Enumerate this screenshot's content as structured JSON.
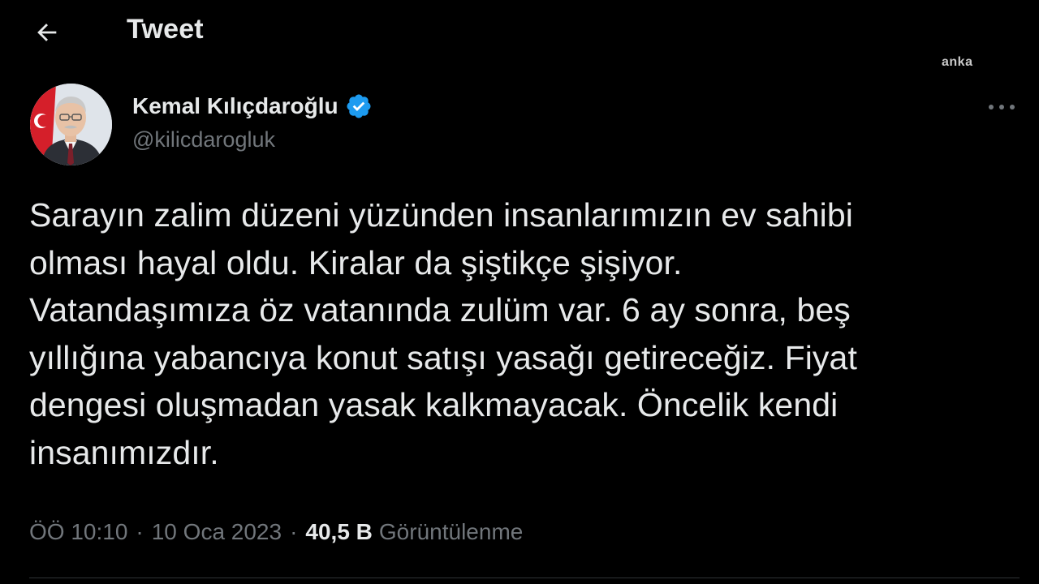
{
  "header": {
    "title": "Tweet",
    "back_icon": "arrow-left-icon",
    "watermark": "anka"
  },
  "author": {
    "name": "Kemal Kılıçdaroğlu",
    "handle": "@kilicdarogluk",
    "verified": true,
    "verified_color": "#1d9bf0",
    "avatar": "avatar-photo"
  },
  "tweet": {
    "text": "Sarayın zalim düzeni yüzünden insanlarımızın ev sahibi\nolması hayal oldu. Kiralar da şiştikçe şişiyor.\nVatandaşımıza öz vatanında zulüm var. 6 ay sonra, beş\nyıllığına yabancıya konut satışı yasağı getireceğiz. Fiyat\ndengesi oluşmadan yasak kalkmayacak. Öncelik kendi\ninsanımızdır."
  },
  "meta": {
    "time": "ÖÖ 10:10",
    "separator": "·",
    "date": "10 Oca 2023",
    "views_count": "40,5 B",
    "views_label": "Görüntülenme"
  },
  "colors": {
    "background": "#000000",
    "primary_text": "#e7e9ea",
    "secondary_text": "#71767b",
    "accent": "#1d9bf0"
  }
}
